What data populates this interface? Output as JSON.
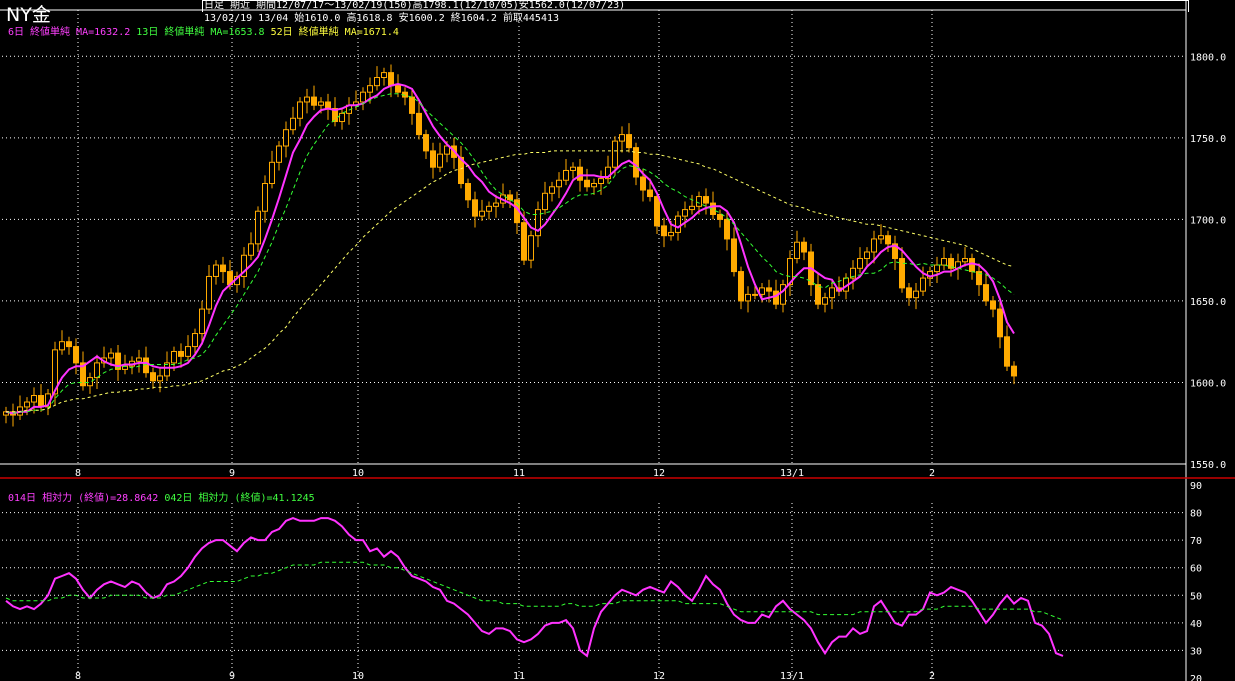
{
  "header": {
    "title": "NY金",
    "info_line1": "日足 期近 期間12/07/17～13/02/19(150)高1798.1(12/10/05)安1562.0(12/07/23)",
    "info_line2": "13/02/19 13/04 始1610.0 高1618.8 安1600.2 終1604.2 前取445413",
    "ma_labels": [
      {
        "text": "6日 終値単純 MA=1632.2",
        "color": "#ff40ff"
      },
      {
        "text": "13日 終値単純 MA=1653.8",
        "color": "#40ff40"
      },
      {
        "text": "52日 終値単純 MA=1671.4",
        "color": "#ffff40"
      }
    ],
    "rsi_labels": [
      {
        "text": "014日 相対力 (終値)=28.8642",
        "color": "#ff40ff"
      },
      {
        "text": "042日 相対力 (終値)=41.1245",
        "color": "#40ff40"
      }
    ]
  },
  "colors": {
    "candle": "#ffaa00",
    "ma6": "#ff33ff",
    "ma13": "#33ff33",
    "ma52": "#ffff66",
    "grid": "#ffffff",
    "axis_text": "#ffffff",
    "separator": "#cc0000"
  },
  "chart_data": [
    {
      "type": "candlestick",
      "title": "NY金",
      "x_tick_labels": [
        {
          "label": "8",
          "index": 10
        },
        {
          "label": "9",
          "index": 32
        },
        {
          "label": "10",
          "index": 50
        },
        {
          "label": "11",
          "index": 73
        },
        {
          "label": "12",
          "index": 93
        },
        {
          "label": "13/1",
          "index": 112
        },
        {
          "label": "2",
          "index": 132
        }
      ],
      "ylim": [
        1550,
        1810
      ],
      "y_ticks": [
        1550,
        1600,
        1650,
        1700,
        1750,
        1800
      ],
      "y_tick_labels": [
        "1550.0",
        "1600.0",
        "1650.0",
        "1700.0",
        "1750.0",
        "1800.0"
      ],
      "grid": true,
      "closes": [
        1582,
        1580,
        1585,
        1588,
        1592,
        1585,
        1593,
        1620,
        1625,
        1622,
        1612,
        1598,
        1603,
        1612,
        1615,
        1618,
        1608,
        1610,
        1613,
        1615,
        1606,
        1601,
        1604,
        1612,
        1619,
        1616,
        1622,
        1630,
        1645,
        1665,
        1672,
        1668,
        1660,
        1665,
        1678,
        1685,
        1705,
        1722,
        1735,
        1745,
        1755,
        1762,
        1772,
        1775,
        1770,
        1772,
        1768,
        1760,
        1765,
        1770,
        1772,
        1778,
        1782,
        1787,
        1790,
        1782,
        1778,
        1775,
        1765,
        1752,
        1742,
        1732,
        1740,
        1745,
        1738,
        1722,
        1712,
        1702,
        1705,
        1708,
        1710,
        1715,
        1712,
        1698,
        1675,
        1690,
        1706,
        1716,
        1720,
        1724,
        1730,
        1732,
        1724,
        1720,
        1722,
        1725,
        1732,
        1748,
        1752,
        1744,
        1726,
        1718,
        1714,
        1696,
        1690,
        1692,
        1702,
        1706,
        1708,
        1714,
        1710,
        1703,
        1700,
        1688,
        1668,
        1650,
        1654,
        1654,
        1658,
        1656,
        1648,
        1660,
        1676,
        1686,
        1680,
        1660,
        1648,
        1652,
        1658,
        1656,
        1664,
        1670,
        1676,
        1680,
        1688,
        1690,
        1685,
        1676,
        1658,
        1652,
        1656,
        1664,
        1668,
        1672,
        1676,
        1670,
        1674,
        1676,
        1668,
        1660,
        1650,
        1645,
        1628,
        1610,
        1604
      ],
      "series": [
        {
          "name": "6日 終値単純",
          "values": [
            1582,
            1581,
            1582,
            1582,
            1585,
            1585,
            1586,
            1595,
            1603,
            1608,
            1610,
            1610,
            1613,
            1616,
            1613,
            1611,
            1610,
            1611,
            1611,
            1612,
            1612,
            1610,
            1609,
            1609,
            1609,
            1610,
            1612,
            1617,
            1624,
            1635,
            1647,
            1656,
            1660,
            1664,
            1668,
            1672,
            1677,
            1688,
            1700,
            1713,
            1727,
            1741,
            1749,
            1758,
            1763,
            1767,
            1768,
            1767,
            1768,
            1770,
            1770,
            1771,
            1774,
            1776,
            1780,
            1782,
            1783,
            1782,
            1780,
            1773,
            1765,
            1757,
            1751,
            1746,
            1742,
            1737,
            1733,
            1727,
            1723,
            1717,
            1714,
            1712,
            1710,
            1707,
            1701,
            1695,
            1693,
            1697,
            1703,
            1709,
            1716,
            1724,
            1727,
            1727,
            1727,
            1726,
            1726,
            1730,
            1734,
            1736,
            1733,
            1728,
            1724,
            1716,
            1706,
            1697,
            1695,
            1698,
            1701,
            1705,
            1707,
            1708,
            1708,
            1705,
            1698,
            1685,
            1671,
            1660,
            1651,
            1652,
            1653,
            1656,
            1661,
            1666,
            1670,
            1670,
            1667,
            1664,
            1663,
            1656,
            1659,
            1662,
            1665,
            1671,
            1675,
            1680,
            1683,
            1684,
            1681,
            1676,
            1671,
            1667,
            1665,
            1666,
            1668,
            1668,
            1670,
            1672,
            1673,
            1672,
            1668,
            1662,
            1651,
            1637,
            1630
          ]
        },
        {
          "name": "13日 終値単純",
          "values": [
            1582,
            1581,
            1582,
            1582,
            1583,
            1583,
            1584,
            1590,
            1595,
            1599,
            1600,
            1600,
            1600,
            1603,
            1606,
            1608,
            1609,
            1610,
            1609,
            1610,
            1611,
            1611,
            1611,
            1611,
            1611,
            1612,
            1614,
            1615,
            1617,
            1622,
            1629,
            1635,
            1641,
            1647,
            1654,
            1661,
            1668,
            1677,
            1686,
            1697,
            1707,
            1718,
            1729,
            1739,
            1746,
            1752,
            1758,
            1761,
            1765,
            1767,
            1769,
            1771,
            1773,
            1775,
            1776,
            1777,
            1777,
            1776,
            1775,
            1772,
            1767,
            1763,
            1759,
            1755,
            1751,
            1747,
            1742,
            1736,
            1729,
            1723,
            1718,
            1715,
            1712,
            1710,
            1705,
            1703,
            1703,
            1704,
            1705,
            1707,
            1710,
            1713,
            1715,
            1715,
            1716,
            1718,
            1721,
            1727,
            1731,
            1733,
            1732,
            1731,
            1729,
            1726,
            1722,
            1719,
            1717,
            1714,
            1712,
            1710,
            1708,
            1706,
            1704,
            1701,
            1697,
            1692,
            1687,
            1682,
            1677,
            1673,
            1668,
            1666,
            1665,
            1665,
            1664,
            1662,
            1659,
            1658,
            1661,
            1662,
            1664,
            1665,
            1666,
            1667,
            1667,
            1669,
            1673,
            1674,
            1673,
            1673,
            1672,
            1673,
            1672,
            1672,
            1672,
            1671,
            1670,
            1669,
            1668,
            1667,
            1666,
            1664,
            1661,
            1657,
            1654
          ]
        },
        {
          "name": "52日 終値単純",
          "values": [
            1582,
            1582,
            1582,
            1583,
            1583,
            1583,
            1584,
            1586,
            1588,
            1589,
            1590,
            1590,
            1591,
            1592,
            1593,
            1594,
            1594,
            1595,
            1595,
            1596,
            1596,
            1597,
            1597,
            1597,
            1598,
            1598,
            1599,
            1600,
            1601,
            1603,
            1605,
            1607,
            1608,
            1610,
            1612,
            1615,
            1618,
            1621,
            1625,
            1630,
            1634,
            1640,
            1645,
            1650,
            1655,
            1660,
            1665,
            1670,
            1675,
            1680,
            1684,
            1689,
            1693,
            1697,
            1701,
            1705,
            1708,
            1711,
            1714,
            1717,
            1720,
            1723,
            1725,
            1728,
            1730,
            1731,
            1733,
            1734,
            1735,
            1736,
            1737,
            1738,
            1739,
            1740,
            1740,
            1741,
            1741,
            1741,
            1742,
            1742,
            1742,
            1742,
            1742,
            1742,
            1742,
            1742,
            1742,
            1742,
            1742,
            1742,
            1741,
            1741,
            1740,
            1740,
            1739,
            1738,
            1737,
            1736,
            1735,
            1734,
            1732,
            1731,
            1729,
            1727,
            1725,
            1723,
            1721,
            1719,
            1717,
            1715,
            1713,
            1711,
            1709,
            1708,
            1707,
            1705,
            1704,
            1703,
            1702,
            1701,
            1700,
            1699,
            1698,
            1697,
            1697,
            1696,
            1695,
            1694,
            1693,
            1692,
            1691,
            1690,
            1689,
            1688,
            1687,
            1686,
            1685,
            1684,
            1682,
            1680,
            1678,
            1676,
            1674,
            1672,
            1671
          ]
        }
      ]
    },
    {
      "type": "line",
      "title": "",
      "ylim": [
        20,
        90
      ],
      "y_ticks": [
        20,
        30,
        40,
        50,
        60,
        70,
        80,
        90
      ],
      "y_tick_labels": [
        "20",
        "30",
        "40",
        "50",
        "60",
        "70",
        "80",
        "90"
      ],
      "x_tick_labels": [
        {
          "label": "8",
          "index": 10
        },
        {
          "label": "9",
          "index": 32
        },
        {
          "label": "10",
          "index": 50
        },
        {
          "label": "11",
          "index": 73
        },
        {
          "label": "12",
          "index": 93
        },
        {
          "label": "13/1",
          "index": 112
        },
        {
          "label": "2",
          "index": 132
        }
      ],
      "grid": true,
      "series": [
        {
          "name": "014日 相対力 (終値)",
          "values": [
            48,
            46,
            45,
            46,
            45,
            47,
            50,
            56,
            57,
            58,
            56,
            52,
            49,
            52,
            54,
            55,
            54,
            53,
            55,
            54,
            51,
            49,
            50,
            54,
            55,
            57,
            60,
            64,
            67,
            69,
            70,
            70,
            68,
            66,
            69,
            71,
            70,
            70,
            73,
            74,
            77,
            78,
            77,
            77,
            77,
            78,
            78,
            77,
            75,
            72,
            70,
            70,
            66,
            67,
            64,
            66,
            64,
            60,
            57,
            56,
            55,
            53,
            52,
            48,
            47,
            45,
            43,
            40,
            37,
            36,
            38,
            38,
            37,
            34,
            33,
            34,
            36,
            39,
            40,
            40,
            41,
            38,
            30,
            28,
            38,
            44,
            47,
            50,
            52,
            51,
            50,
            52,
            53,
            52,
            51,
            55,
            53,
            50,
            48,
            52,
            57,
            54,
            52,
            47,
            43,
            41,
            40,
            40,
            43,
            42,
            46,
            48,
            45,
            43,
            41,
            38,
            33,
            29,
            33,
            35,
            35,
            38,
            36,
            37,
            46,
            48,
            44,
            40,
            39,
            43,
            43,
            45,
            51,
            50,
            51,
            53,
            52,
            51,
            48,
            44,
            40,
            43,
            47,
            50,
            47,
            49,
            48,
            40,
            39,
            36,
            29,
            28
          ]
        },
        {
          "name": "042日 相対力 (終値)",
          "values": [
            49,
            48,
            48,
            48,
            48,
            48,
            48,
            49,
            49,
            50,
            50,
            49,
            49,
            49,
            49,
            50,
            50,
            50,
            50,
            50,
            49,
            49,
            49,
            50,
            50,
            51,
            52,
            53,
            54,
            55,
            55,
            55,
            55,
            55,
            56,
            57,
            57,
            58,
            58,
            59,
            60,
            61,
            61,
            61,
            61,
            62,
            62,
            62,
            62,
            62,
            62,
            62,
            61,
            61,
            61,
            60,
            60,
            59,
            58,
            57,
            56,
            55,
            54,
            53,
            52,
            51,
            50,
            49,
            48,
            48,
            48,
            47,
            47,
            47,
            46,
            46,
            46,
            46,
            46,
            46,
            47,
            47,
            46,
            46,
            46,
            47,
            47,
            47,
            48,
            48,
            48,
            48,
            48,
            48,
            48,
            48,
            48,
            47,
            47,
            47,
            47,
            47,
            47,
            46,
            45,
            44,
            44,
            44,
            44,
            44,
            44,
            44,
            44,
            44,
            44,
            44,
            43,
            43,
            43,
            43,
            43,
            43,
            44,
            44,
            44,
            44,
            44,
            44,
            44,
            44,
            44,
            45,
            45,
            45,
            46,
            46,
            46,
            46,
            46,
            45,
            45,
            45,
            45,
            45,
            45,
            45,
            45,
            44,
            44,
            43,
            42,
            41
          ]
        }
      ]
    }
  ]
}
